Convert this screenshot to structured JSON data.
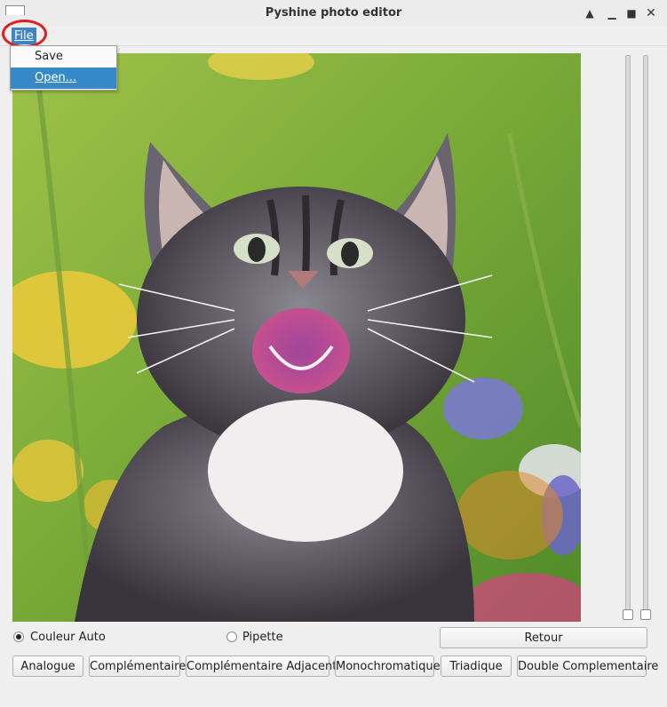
{
  "window": {
    "title": "Pyshine photo editor"
  },
  "menubar": {
    "file_label": "File"
  },
  "file_menu": {
    "items": [
      "Save",
      "Open..."
    ],
    "selected": "Open..."
  },
  "photo": {
    "description_icon": "kitten-photo"
  },
  "sliders": [
    {
      "name": "vertical-slider-1"
    },
    {
      "name": "vertical-slider-2"
    }
  ],
  "modes": [
    {
      "label": "Couleur Auto",
      "checked": true
    },
    {
      "label": "Pipette",
      "checked": false
    }
  ],
  "buttons": {
    "retour": "Retour",
    "analogue": "Analogue",
    "complementaire": "Complémentaire",
    "complementaire_adjacente": "Complémentaire Adjacente",
    "monochromatique": "Monochromatique",
    "triadique": "Triadique",
    "double_complementaire": "Double Complementaire"
  },
  "colors": {
    "menu_highlight": "#3589c7",
    "annotation": "#e02020"
  }
}
